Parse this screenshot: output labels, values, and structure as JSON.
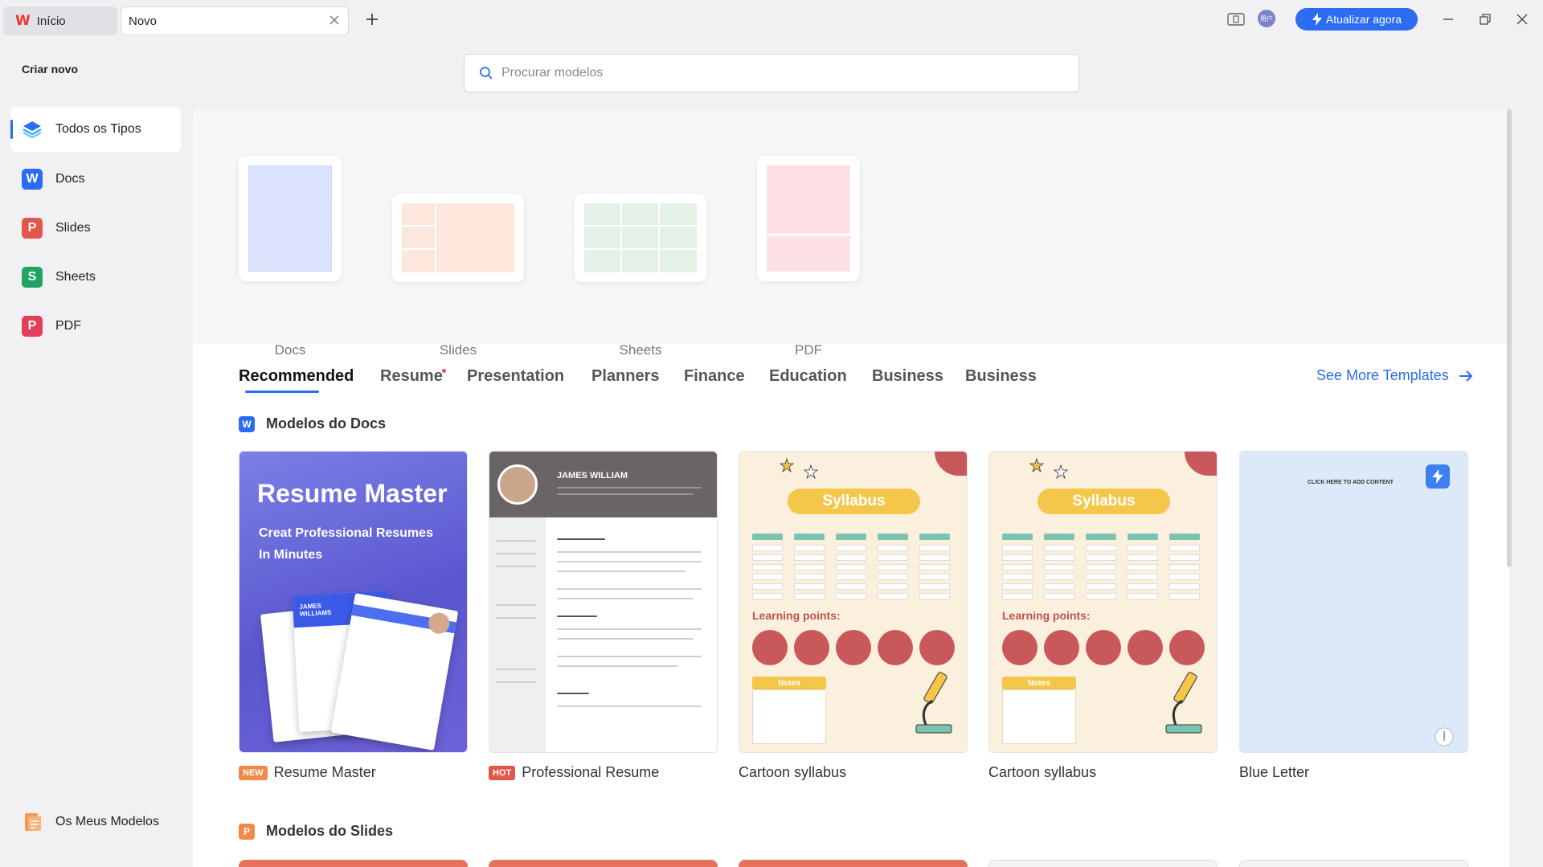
{
  "titlebar": {
    "tabs": [
      {
        "label": "Início"
      },
      {
        "label": "Novo"
      }
    ],
    "upgrade_label": "Atualizar agora",
    "avatar_text": "用户"
  },
  "search": {
    "placeholder": "Procurar modelos"
  },
  "sidebar": {
    "title": "Criar novo",
    "items": [
      {
        "label": "Todos os Tipos",
        "icon": "layers-icon"
      },
      {
        "label": "Docs",
        "icon": "docs-icon",
        "glyph": "W"
      },
      {
        "label": "Slides",
        "icon": "slides-icon",
        "glyph": "P"
      },
      {
        "label": "Sheets",
        "icon": "sheets-icon",
        "glyph": "S"
      },
      {
        "label": "PDF",
        "icon": "pdf-icon",
        "glyph": "P"
      }
    ],
    "footer_label": "Os Meus Modelos"
  },
  "create": [
    {
      "label": "Docs"
    },
    {
      "label": "Slides"
    },
    {
      "label": "Sheets"
    },
    {
      "label": "PDF"
    }
  ],
  "categories": [
    {
      "label": "Recommended"
    },
    {
      "label": "Resume"
    },
    {
      "label": "Presentation"
    },
    {
      "label": "Planners"
    },
    {
      "label": "Finance"
    },
    {
      "label": "Education"
    },
    {
      "label": "Business"
    },
    {
      "label": "Business"
    }
  ],
  "see_more": "See More Templates",
  "sections": {
    "docs_title": "Modelos do Docs",
    "slides_title": "Modelos do Slides"
  },
  "templates": [
    {
      "name": "Resume Master",
      "badge": "NEW",
      "badge_color": "#f08a4b",
      "headline": "Resume Master",
      "sub": "Creat Professional Resumes In Minutes",
      "paper_name": "JAMES WILLIAMS"
    },
    {
      "name": "Professional Resume",
      "badge": "HOT",
      "badge_color": "#e2574c",
      "resume_name": "JAMES WILLIAM"
    },
    {
      "name": "Cartoon syllabus",
      "banner": "Syllabus",
      "learning": "Learning points:",
      "notes": "Notes"
    },
    {
      "name": "Cartoon syllabus",
      "banner": "Syllabus",
      "learning": "Learning points:",
      "notes": "Notes"
    },
    {
      "name": "Blue Letter",
      "letter_text": "CLICK HERE TO ADD CONTENT"
    }
  ],
  "colors": {
    "accent": "#2b6cf2",
    "docs": "#2b6cf2",
    "slides": "#e2574c",
    "sheets": "#1fa463",
    "pdf": "#e0405a"
  }
}
